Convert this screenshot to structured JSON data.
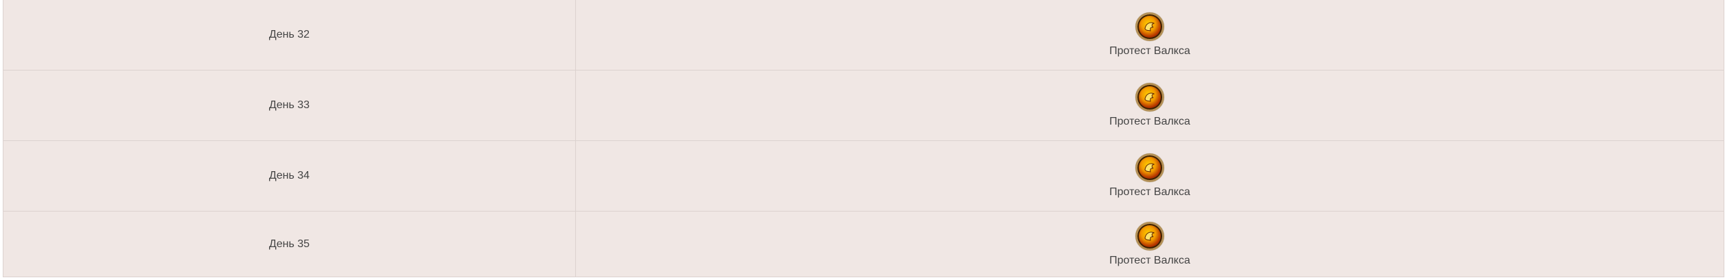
{
  "rows": [
    {
      "day": "День 32",
      "reward": {
        "name": "Протест Валкса",
        "icon": "valks-protest-icon"
      }
    },
    {
      "day": "День 33",
      "reward": {
        "name": "Протест Валкса",
        "icon": "valks-protest-icon"
      }
    },
    {
      "day": "День 34",
      "reward": {
        "name": "Протест Валкса",
        "icon": "valks-protest-icon"
      }
    },
    {
      "day": "День 35",
      "reward": {
        "name": "Протест Валкса",
        "icon": "valks-protest-icon"
      }
    }
  ]
}
